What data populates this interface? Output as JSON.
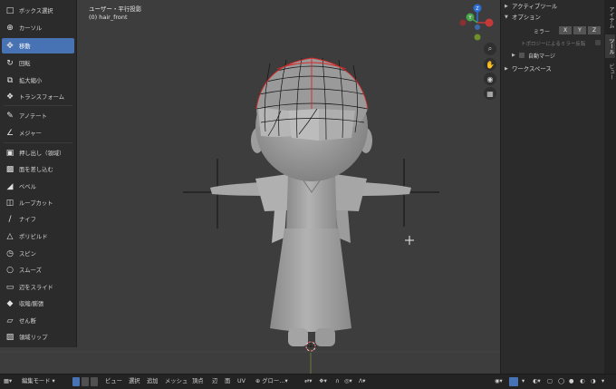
{
  "viewport": {
    "view_label": "ユーザー・平行投影",
    "object_label": "(0) hair_front"
  },
  "toolbar": {
    "items": [
      {
        "label": "ボックス選択",
        "icon": "select-box-icon",
        "active": false
      },
      {
        "label": "カーソル",
        "icon": "cursor-icon",
        "active": false
      },
      {
        "label": "移動",
        "icon": "move-icon",
        "active": true
      },
      {
        "label": "回転",
        "icon": "rotate-icon",
        "active": false
      },
      {
        "label": "拡大縮小",
        "icon": "scale-icon",
        "active": false
      },
      {
        "label": "トランスフォーム",
        "icon": "transform-icon",
        "active": false
      },
      {
        "label": "アノテート",
        "icon": "annotate-icon",
        "active": false
      },
      {
        "label": "メジャー",
        "icon": "measure-icon",
        "active": false
      },
      {
        "label": "押し出し（領域）",
        "icon": "extrude-region-icon",
        "active": false
      },
      {
        "label": "面を差し込む",
        "icon": "inset-faces-icon",
        "active": false
      },
      {
        "label": "ベベル",
        "icon": "bevel-icon",
        "active": false
      },
      {
        "label": "ループカット",
        "icon": "loop-cut-icon",
        "active": false
      },
      {
        "label": "ナイフ",
        "icon": "knife-icon",
        "active": false
      },
      {
        "label": "ポリビルド",
        "icon": "poly-build-icon",
        "active": false
      },
      {
        "label": "スピン",
        "icon": "spin-icon",
        "active": false
      },
      {
        "label": "スムーズ",
        "icon": "smooth-icon",
        "active": false
      },
      {
        "label": "辺をスライド",
        "icon": "edge-slide-icon",
        "active": false
      },
      {
        "label": "収縮/膨張",
        "icon": "shrink-fatten-icon",
        "active": false
      },
      {
        "label": "せん断",
        "icon": "shear-icon",
        "active": false
      },
      {
        "label": "領域リップ",
        "icon": "rip-region-icon",
        "active": false
      }
    ]
  },
  "gizmo": {
    "z_label": "Z",
    "y_label": "Y",
    "x_label": "X"
  },
  "sidebar": {
    "active_tool_header": "アクティブツール",
    "options_header": "オプション",
    "mirror_label": "ミラー",
    "mirror_axes": [
      "X",
      "Y",
      "Z"
    ],
    "topology_mirror_label": "トポロジーによるミラー反転",
    "auto_merge_label": "自動マージ",
    "workspace_header": "ワークスペース"
  },
  "tabs": [
    "アイテム",
    "ツール",
    "ビュー"
  ],
  "statusbar": {
    "mode_label": "編集モード",
    "menus": [
      "ビュー",
      "選択",
      "追加",
      "メッシュ",
      "頂点",
      "辺",
      "面",
      "UV"
    ],
    "transform_orientation": "グロー…"
  },
  "colors": {
    "accent": "#4772b3",
    "background": "#3d3d3d",
    "panel": "#2b2b2b",
    "wire_seam": "#d42a2a"
  }
}
